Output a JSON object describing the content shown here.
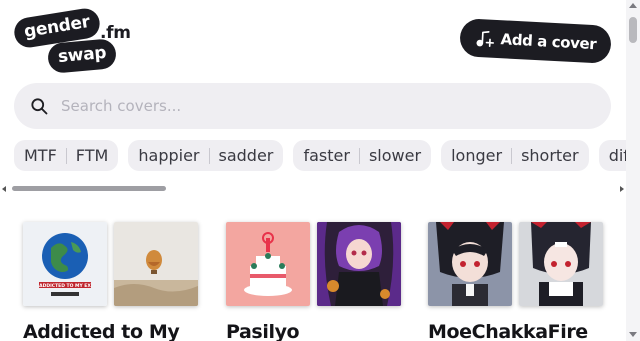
{
  "header": {
    "logo_line1": "gender",
    "logo_line2": "swap",
    "logo_tld": ".fm",
    "add_cover_label": "Add a cover"
  },
  "search": {
    "placeholder": "Search covers..."
  },
  "filters": [
    {
      "a": "MTF",
      "b": "FTM"
    },
    {
      "a": "happier",
      "b": "sadder"
    },
    {
      "a": "faster",
      "b": "slower"
    },
    {
      "a": "longer",
      "b": "shorter"
    },
    {
      "a": "differ",
      "b": ""
    }
  ],
  "cards": [
    {
      "title": "Addicted to My",
      "left_cover_text": "ADDICTED TO MY EX"
    },
    {
      "title": "Pasilyo"
    },
    {
      "title": "MoeChakkaFire"
    }
  ],
  "icons": {
    "search": "search-icon",
    "add_cover": "music-note-plus-icon"
  },
  "colors": {
    "dark": "#1c1c22",
    "chip_bg": "#efeef2",
    "search_bg": "#efeef2",
    "placeholder": "#b4b3bc"
  }
}
